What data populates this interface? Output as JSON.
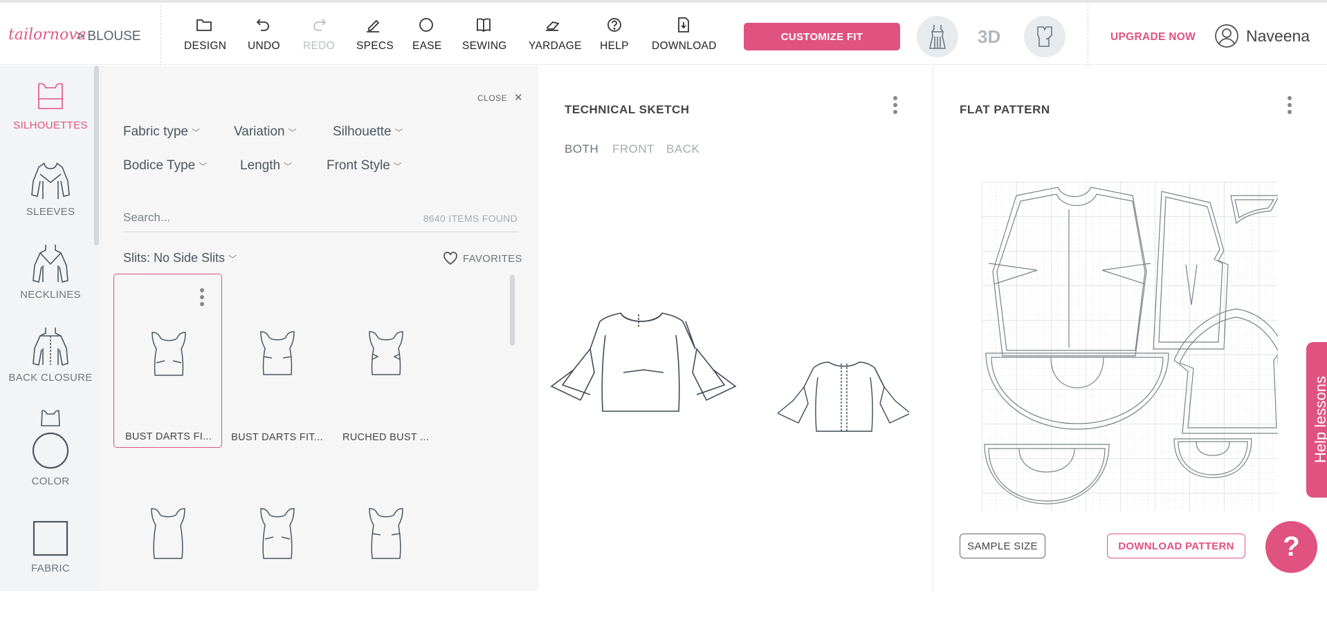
{
  "brand": {
    "logo_text": "tailornova",
    "separator": ">",
    "breadcrumb": "BLOUSE",
    "accent": "#e0527f"
  },
  "toolbar": [
    {
      "label": "DESIGN",
      "icon": "folder-icon",
      "disabled": false
    },
    {
      "label": "UNDO",
      "icon": "undo-icon",
      "disabled": false
    },
    {
      "label": "REDO",
      "icon": "redo-icon",
      "disabled": true
    },
    {
      "label": "SPECS",
      "icon": "pencil-icon",
      "disabled": false
    },
    {
      "label": "EASE",
      "icon": "circle-icon",
      "disabled": false
    },
    {
      "label": "SEWING",
      "icon": "book-icon",
      "disabled": false
    },
    {
      "label": "YARDAGE",
      "icon": "eraser-icon",
      "disabled": false
    },
    {
      "label": "HELP",
      "icon": "help-icon",
      "disabled": false
    },
    {
      "label": "DOWNLOAD",
      "icon": "download-icon",
      "disabled": false
    }
  ],
  "header": {
    "customize_label": "CUSTOMIZE FIT",
    "view3d_label": "3D",
    "upgrade_label": "UPGRADE NOW",
    "username": "Naveena"
  },
  "rail": [
    {
      "label": "SILHOUETTES",
      "active": true
    },
    {
      "label": "SLEEVES",
      "active": false
    },
    {
      "label": "NECKLINES",
      "active": false
    },
    {
      "label": "BACK CLOSURE",
      "active": false
    },
    {
      "label": "COLOR",
      "active": false
    },
    {
      "label": "FABRIC",
      "active": false
    }
  ],
  "panel": {
    "close_label": "CLOSE",
    "filters": [
      "Fabric type",
      "Variation",
      "Silhouette",
      "Bodice Type",
      "Length",
      "Front Style"
    ],
    "search_placeholder": "Search...",
    "items_found": "8640 ITEMS FOUND",
    "slits_label": "Slits: No Side Slits",
    "favorites_label": "FAVORITES",
    "cards": [
      {
        "caption": "BUST DARTS FI...",
        "selected": true
      },
      {
        "caption": "BUST DARTS FIT...",
        "selected": false
      },
      {
        "caption": "RUCHED BUST ...",
        "selected": false
      },
      {
        "caption": "",
        "selected": false
      },
      {
        "caption": "",
        "selected": false
      },
      {
        "caption": "",
        "selected": false
      }
    ]
  },
  "sketch": {
    "title": "TECHNICAL SKETCH",
    "tabs": [
      "BOTH",
      "FRONT",
      "BACK"
    ],
    "active_tab": "BOTH"
  },
  "flat": {
    "title": "FLAT PATTERN",
    "sample_size_label": "SAMPLE SIZE",
    "download_label": "DOWNLOAD PATTERN"
  },
  "help": {
    "tab_label": "Help lessons",
    "fab_label": "?"
  }
}
